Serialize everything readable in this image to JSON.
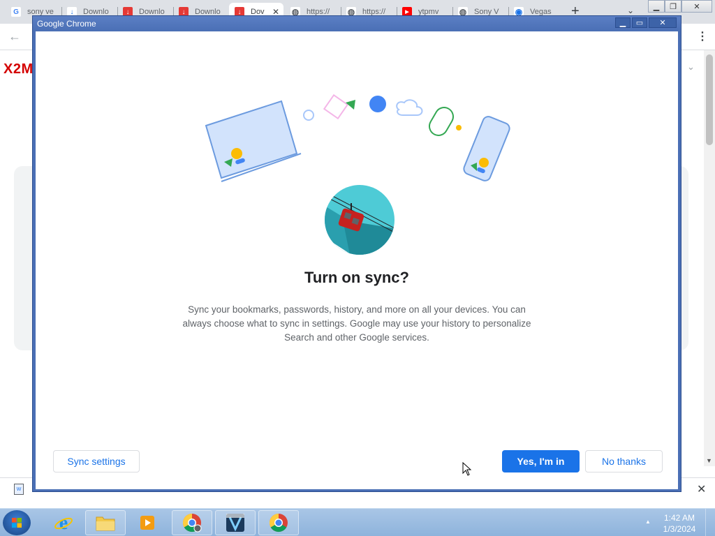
{
  "browser": {
    "tabs": [
      {
        "label": "sony ve",
        "icon": "google-icon",
        "color": "#4285f4"
      },
      {
        "label": "Downlo",
        "icon": "download-icon",
        "color": "#1a73e8"
      },
      {
        "label": "Downlo",
        "icon": "download-red-icon",
        "color": "#e53935"
      },
      {
        "label": "Downlo",
        "icon": "download-red-icon",
        "color": "#e53935"
      },
      {
        "label": "Dov",
        "icon": "download-red-icon",
        "color": "#e53935"
      },
      {
        "label": "https://",
        "icon": "globe-icon",
        "color": "#5f6368"
      },
      {
        "label": "https://",
        "icon": "globe-icon",
        "color": "#5f6368"
      },
      {
        "label": "ytpmv",
        "icon": "youtube-icon",
        "color": "#ff0000"
      },
      {
        "label": "Sony V",
        "icon": "globe-icon",
        "color": "#5f6368"
      },
      {
        "label": "Vegas",
        "icon": "vegas-icon",
        "color": "#1a73e8"
      }
    ],
    "site_logo": "X2M"
  },
  "dialog": {
    "window_title": "Google Chrome",
    "headline": "Turn on sync?",
    "body": "Sync your bookmarks, passwords, history, and more on all your devices. You can always choose what to sync in settings. Google may use your history to personalize Search and other Google services.",
    "buttons": {
      "sync_settings": "Sync settings",
      "yes": "Yes, I'm in",
      "no": "No thanks"
    }
  },
  "taskbar": {
    "time": "1:42 AM",
    "date": "1/3/2024"
  },
  "colors": {
    "accent": "#1a73e8",
    "dialog_frame": "#4a6fb5",
    "taskbar": "#9ebde2"
  }
}
